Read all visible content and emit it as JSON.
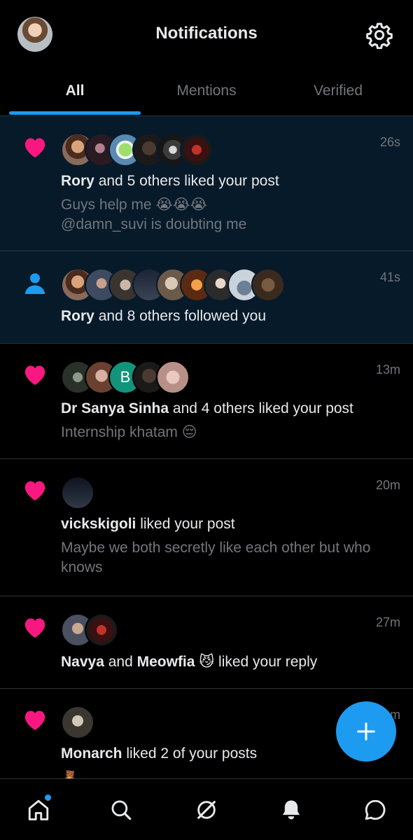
{
  "header": {
    "title": "Notifications"
  },
  "tabs": [
    {
      "label": "All"
    },
    {
      "label": "Mentions"
    },
    {
      "label": "Verified"
    }
  ],
  "notifications": [
    {
      "kind": "like",
      "time": "26s",
      "actor": "Rory",
      "rest": " and 5 others liked your post",
      "sub1": "Guys help me 😭😭😭",
      "sub2": "@damn_suvi is doubting me",
      "avatar_count": 6
    },
    {
      "kind": "follow",
      "time": "41s",
      "actor": "Rory",
      "rest": " and 8 others followed you",
      "avatar_count": 9
    },
    {
      "kind": "like",
      "time": "13m",
      "actor": "Dr Sanya Sinha",
      "rest": " and 4 others liked your post",
      "sub1": "Internship khatam 😔",
      "avatar_letter": "B",
      "avatar_count": 5
    },
    {
      "kind": "like",
      "time": "20m",
      "actor": "vickskigoli",
      "rest": " liked your post",
      "sub1": "Maybe we both secretly like each other but who knows",
      "avatar_count": 1
    },
    {
      "kind": "like",
      "time": "27m",
      "actor": "Navya",
      "mid": " and ",
      "actor2": "Meowfia 😼",
      "rest": " liked your reply",
      "avatar_count": 2
    },
    {
      "kind": "like",
      "time": "m",
      "actor": "Monarch",
      "rest": " liked 2 of your posts",
      "sub1": "🧸",
      "avatar_count": 1
    }
  ],
  "colors": {
    "accent": "#1d9bf0",
    "like": "#f91880",
    "unread_bg": "#071a2a"
  },
  "icons": [
    "gear-icon",
    "heart-icon",
    "person-icon",
    "home-icon",
    "search-icon",
    "grok-icon",
    "bell-icon",
    "message-icon",
    "plus-icon"
  ]
}
